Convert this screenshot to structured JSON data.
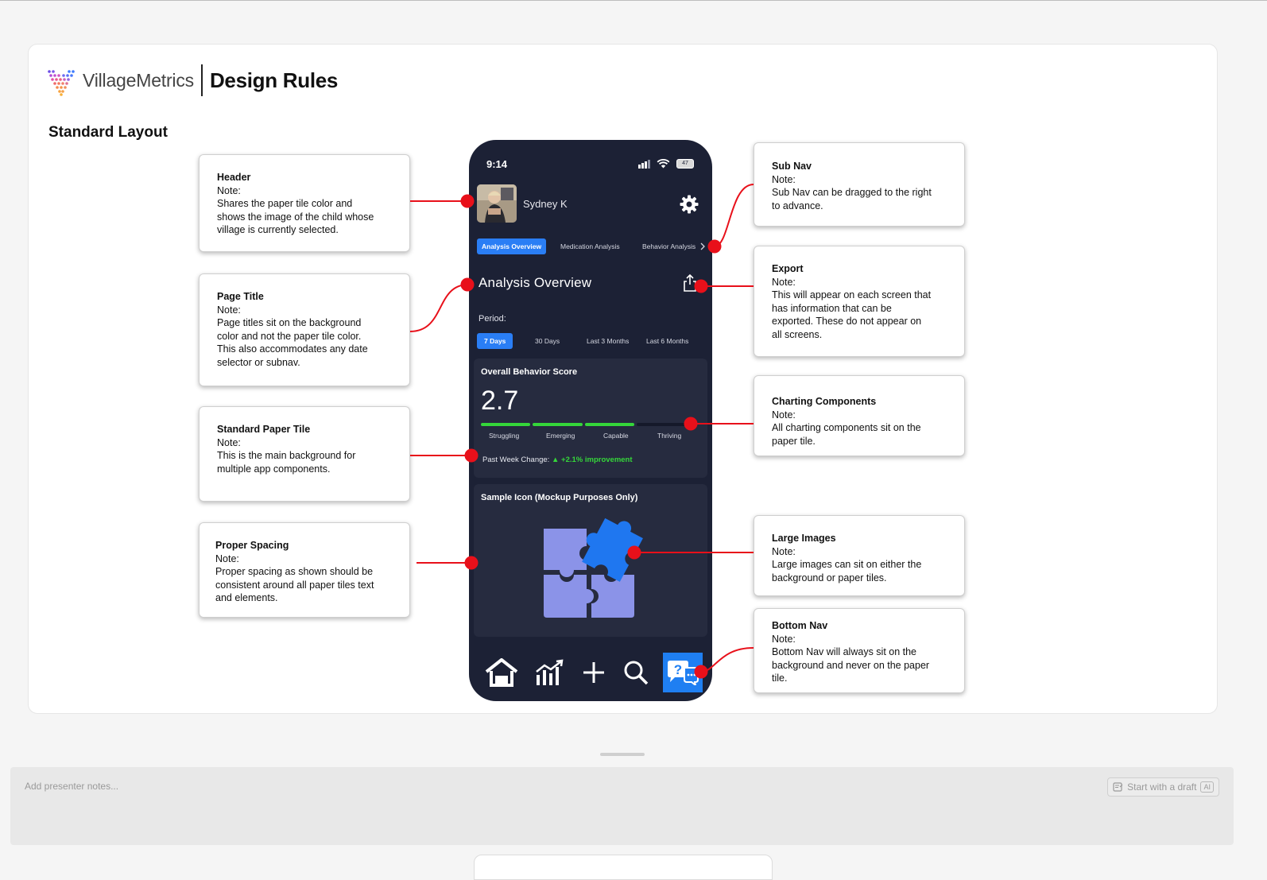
{
  "brand": {
    "name": "VillageMetrics",
    "title": "Design Rules"
  },
  "section_title": "Standard Layout",
  "notes": {
    "header": {
      "title": "Header",
      "note_label": "Note:",
      "body": [
        "Shares the paper tile color and",
        "shows the image of the child whose",
        "village is currently selected."
      ]
    },
    "page_title": {
      "title": "Page Title",
      "note_label": "Note:",
      "body": [
        "Page titles sit on the background",
        "color and not the paper tile color.",
        "This also accommodates any date",
        "selector or subnav."
      ]
    },
    "paper_tile": {
      "title": "Standard Paper Tile",
      "note_label": "Note:",
      "body": [
        "This is the main background for",
        "multiple app components."
      ]
    },
    "spacing": {
      "title": "Proper Spacing",
      "note_label": "Note:",
      "body": [
        "Proper spacing as shown should be",
        "consistent around all paper tiles text",
        "and elements."
      ]
    },
    "subnav": {
      "title": "Sub Nav",
      "note_label": "Note:",
      "body": [
        "Sub Nav can be dragged to the right",
        "to advance."
      ]
    },
    "export": {
      "title": "Export",
      "note_label": "Note:",
      "body": [
        "This will appear on each screen that",
        "has information that can be",
        "exported. These do not appear on",
        "all screens."
      ]
    },
    "charting": {
      "title": "Charting Components",
      "note_label": "Note:",
      "body": [
        "All charting components sit on the",
        "paper tile."
      ]
    },
    "large_images": {
      "title": "Large Images",
      "note_label": "Note:",
      "body": [
        "Large images can sit on either the",
        "background or paper tiles."
      ]
    },
    "bottom_nav": {
      "title": "Bottom Nav",
      "note_label": "Note:",
      "body": [
        "Bottom Nav will always sit on the",
        "background and never on the paper",
        "tile."
      ]
    }
  },
  "phone": {
    "status": {
      "time": "9:14",
      "battery": "47"
    },
    "header": {
      "child_name": "Sydney K"
    },
    "subnav": {
      "tabs": [
        "Analysis Overview",
        "Medication Analysis",
        "Behavior Analysis"
      ],
      "active_index": 0
    },
    "page_title": "Analysis Overview",
    "period": {
      "label": "Period:",
      "options": [
        "7 Days",
        "30 Days",
        "Last 3 Months",
        "Last 6 Months"
      ],
      "active_index": 0
    },
    "behavior_tile": {
      "title": "Overall Behavior Score",
      "score": "2.7",
      "levels": [
        "Struggling",
        "Emerging",
        "Capable",
        "Thriving"
      ],
      "score_value": 2.7,
      "change_label": "Past Week Change:",
      "change_value": "+2.1% improvement"
    },
    "icon_tile": {
      "title": "Sample Icon (Mockup Purposes Only)"
    },
    "bottom_nav": [
      "home-icon",
      "chart-icon",
      "add-icon",
      "search-icon",
      "help-chat-icon"
    ]
  },
  "presenter": {
    "placeholder": "Add presenter notes...",
    "draft_button": "Start with a draft",
    "ai_badge": "AI"
  },
  "colors": {
    "phone_background": "#1c2135",
    "paper_tile": "#262b3f",
    "accent_blue": "#2a7ef5",
    "score_green": "#35d63a",
    "connector_red": "#e8101a",
    "puzzle_light": "#8b93e8",
    "puzzle_blue": "#1f77f0"
  }
}
